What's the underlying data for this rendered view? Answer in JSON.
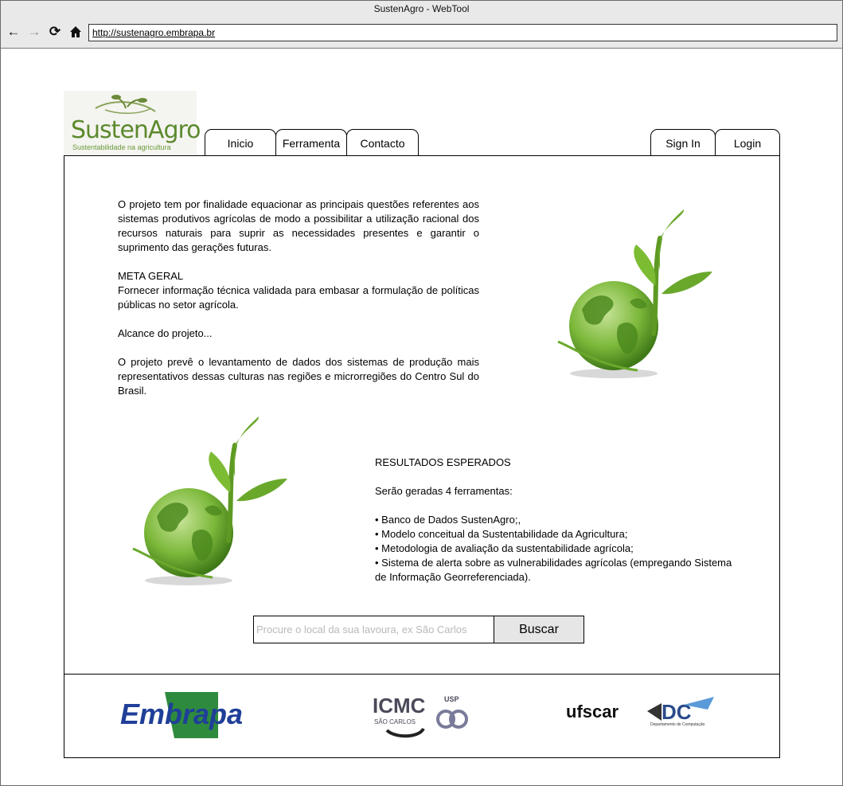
{
  "browser": {
    "window_title": "SustenAgro - WebTool",
    "address": "http://sustenagro.embrapa.br",
    "icons": [
      "back-arrow-icon",
      "forward-arrow-icon",
      "reload-icon",
      "home-icon"
    ]
  },
  "site": {
    "logo_name": "SustenAgro",
    "logo_tagline": "Sustentabilidade na agricultura"
  },
  "nav": {
    "tabs": [
      {
        "label": "Inicio"
      },
      {
        "label": "Ferramenta"
      },
      {
        "label": "Contacto"
      }
    ],
    "signin_label": "Sign In",
    "login_label": "Login"
  },
  "intro": {
    "paragraph1": "O projeto tem por finalidade equacionar as principais questões referentes aos sistemas produtivos agrícolas de modo a possibilitar a utilização racional dos recursos naturais para suprir as necessidades presentes e garantir o suprimento das gerações futuras.",
    "meta_heading": "META GERAL",
    "meta_text": "Fornecer informação técnica validada para embasar a formulação de políticas públicas no setor agrícola.",
    "scope_text": "Alcance do projeto...",
    "paragraph2": "O projeto prevê o levantamento de dados dos sistemas de produção mais representativos dessas culturas nas regiões e microrregiões do Centro Sul do Brasil."
  },
  "results": {
    "heading": "RESULTADOS ESPERADOS",
    "subheading": "Serão geradas 4 ferramentas:",
    "items": [
      "• Banco de Dados SustenAgro;,",
      "• Modelo conceitual da Sustentabilidade da Agricultura;",
      "• Metodologia de avaliação da sustentabilidade agrícola;",
      "• Sistema de alerta sobre as vulnerabilidades agrícolas (empregando Sistema de Informação Georreferenciada)."
    ]
  },
  "search": {
    "placeholder": "Procure o local da sua lavoura, ex São Carlos",
    "button_label": "Buscar"
  },
  "footer": {
    "partners": [
      "Embrapa",
      "ICMC",
      "SÃO CARLOS",
      "USP",
      "ufscar",
      "DC",
      "Departamento de Computação"
    ]
  },
  "colors": {
    "chrome_bg": "#e9e9e9",
    "leaf_green": "#6aa82c",
    "embrapa_blue": "#1f3f98",
    "embrapa_green": "#2e8b3d"
  }
}
